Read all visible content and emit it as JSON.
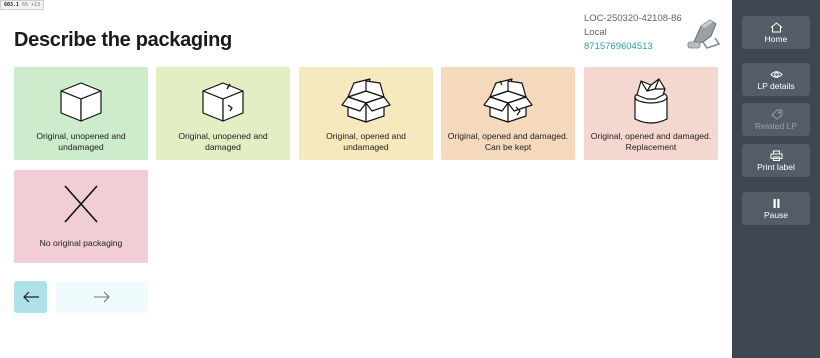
{
  "badge": {
    "version": "603.1",
    "meta": "6% +13"
  },
  "page": {
    "title": "Describe the packaging"
  },
  "info": {
    "location": "LOC-250320-42108-86",
    "mode": "Local",
    "tracking": "8715769604513",
    "tracking_color": "#2f9fa4"
  },
  "options": [
    {
      "label": "Original, unopened and undamaged",
      "icon": "closed-box-icon",
      "color": "#cdeccb"
    },
    {
      "label": "Original, unopened and damaged",
      "icon": "damaged-closed-box-icon",
      "color": "#e2efc4"
    },
    {
      "label": "Original, opened and undamaged",
      "icon": "open-box-icon",
      "color": "#f6e9be"
    },
    {
      "label": "Original, opened and damaged. Can be kept",
      "icon": "damaged-open-box-icon",
      "color": "#f5d9bd"
    },
    {
      "label": "Original, opened and damaged. Replacement",
      "icon": "crushed-box-icon",
      "color": "#f4d8cf"
    },
    {
      "label": "No original packaging",
      "icon": "x-icon",
      "color": "#f1ced6"
    }
  ],
  "nav": {
    "back_icon": "arrow-left-icon",
    "next_icon": "arrow-right-icon"
  },
  "sidebar": {
    "home": "Home",
    "lp_details": "LP details",
    "related_lp": "Related LP",
    "print_label": "Print label",
    "pause": "Pause"
  },
  "colors": {
    "sidebar_bg": "#3e4650",
    "sidebar_button": "#535c67",
    "accent": "#aee1e8"
  }
}
